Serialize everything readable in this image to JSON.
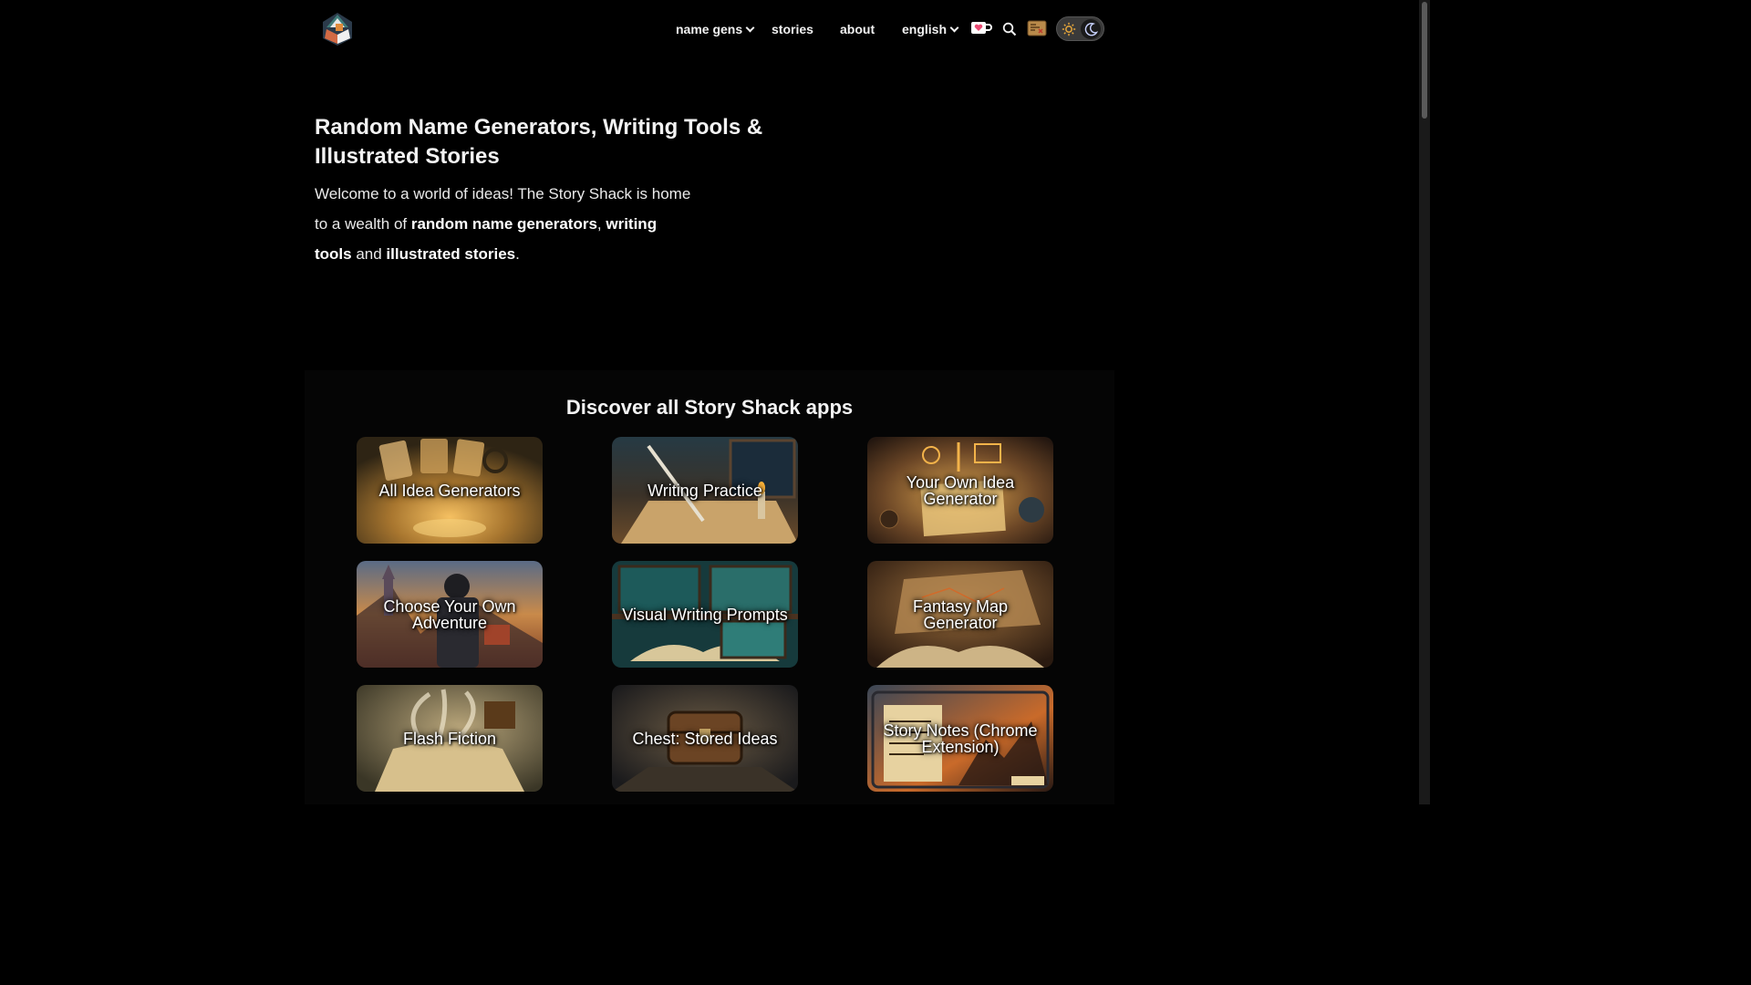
{
  "nav": {
    "name_gens": "name gens",
    "stories": "stories",
    "about": "about",
    "language": "english"
  },
  "hero": {
    "title": "Random Name Generators, Writing Tools & Illustrated Stories",
    "text_1": "Welcome to a world of ideas! The Story Shack is home to a wealth of ",
    "bold_1": "random name generators",
    "text_2": ", ",
    "bold_2": "writing tools",
    "text_3": " and ",
    "bold_3": "illustrated stories",
    "text_4": "."
  },
  "apps": {
    "title": "Discover all Story Shack apps",
    "cards": [
      {
        "label": "All Idea Generators"
      },
      {
        "label": "Writing Practice"
      },
      {
        "label": "Your Own Idea Generator"
      },
      {
        "label": "Choose Your Own Adventure"
      },
      {
        "label": "Visual Writing Prompts"
      },
      {
        "label": "Fantasy Map Generator"
      },
      {
        "label": "Flash Fiction"
      },
      {
        "label": "Chest: Stored Ideas"
      },
      {
        "label": "Story Notes (Chrome Extension)"
      }
    ]
  },
  "icons": {
    "support": "heart-cup-icon",
    "search": "search-icon",
    "treasure": "treasure-map-icon",
    "sun": "sun-icon",
    "moon": "moon-icon"
  },
  "colors": {
    "background": "#000000",
    "text": "#f1f1f1",
    "accent_gold": "#e8a83a",
    "support_pink": "#e94a72"
  }
}
